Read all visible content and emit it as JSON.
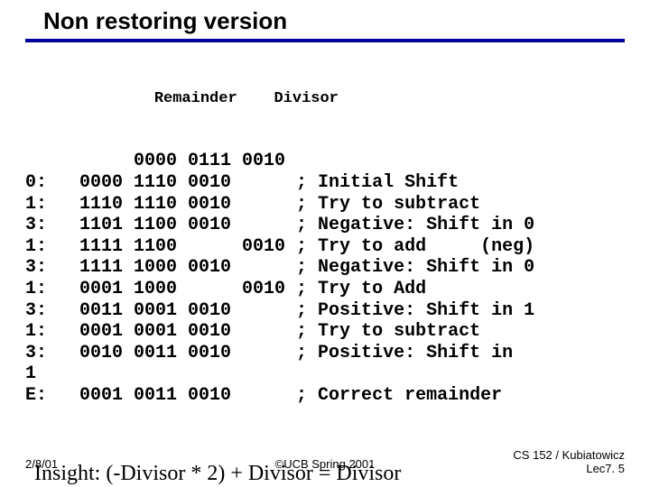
{
  "title": "Non restoring version",
  "head": {
    "remainder": "Remainder",
    "divisor": "Divisor"
  },
  "rows": [
    {
      "step": "",
      "r1": "",
      "r2": "0000",
      "r3": "0111",
      "d": "0010",
      "c": ""
    },
    {
      "step": "0:",
      "r1": "0000",
      "r2": "1110",
      "r3": "0010",
      "d": "",
      "c": "; Initial Shift"
    },
    {
      "step": "1:",
      "r1": "1110",
      "r2": "1110",
      "r3": "0010",
      "d": "",
      "c": "; Try to subtract"
    },
    {
      "step": "3:",
      "r1": "1101",
      "r2": "1100",
      "r3": "0010",
      "d": "",
      "c": "; Negative: Shift in 0"
    },
    {
      "step": "1:",
      "r1": "1111",
      "r2": "1100",
      "r3": "",
      "d": "0010",
      "c": "; Try to add     (neg)"
    },
    {
      "step": "3:",
      "r1": "1111",
      "r2": "1000",
      "r3": "0010",
      "d": "",
      "c": "; Negative: Shift in 0"
    },
    {
      "step": "1:",
      "r1": "0001",
      "r2": "1000",
      "r3": "",
      "d": "0010",
      "c": "; Try to Add"
    },
    {
      "step": "3:",
      "r1": "0011",
      "r2": "0001",
      "r3": "0010",
      "d": "",
      "c": "; Positive: Shift in 1"
    },
    {
      "step": "1:",
      "r1": "0001",
      "r2": "0001",
      "r3": "0010",
      "d": "    ",
      "c": "; Try to subtract"
    },
    {
      "step": "3:",
      "r1": "0010",
      "r2": "0011",
      "r3": "0010",
      "d": "    ",
      "c": "; Positive: Shift in"
    },
    {
      "step": "1",
      "r1": "",
      "r2": "",
      "r3": "",
      "d": "",
      "c": ""
    },
    {
      "step": "E:",
      "r1": "0001",
      "r2": "0011",
      "r3": "0010",
      "d": "    ",
      "c": "; Correct remainder"
    }
  ],
  "insight": "Insight: (-Divisor * 2) + Divisor = Divisor",
  "footer": {
    "left": "2/8/01",
    "center": "©UCB Spring 2001",
    "right1": "CS 152 / Kubiatowicz",
    "right2": "Lec7. 5"
  }
}
